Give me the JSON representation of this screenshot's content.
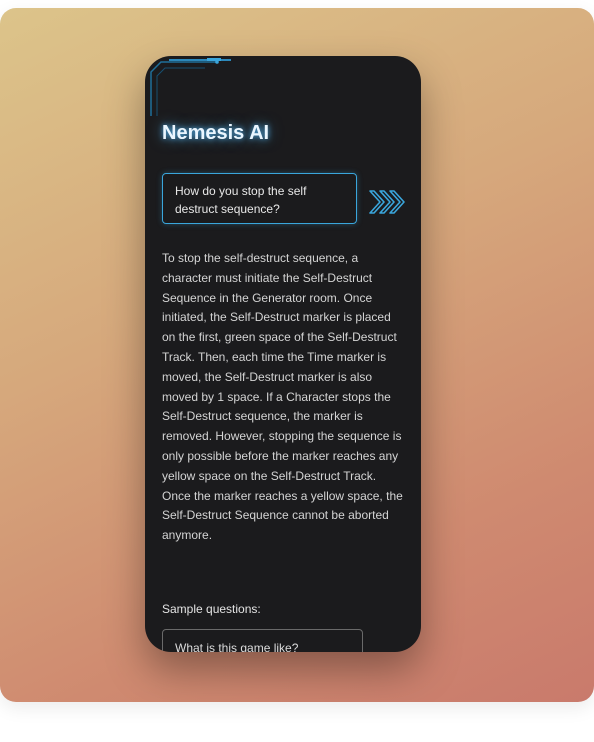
{
  "app": {
    "title": "Nemesis AI"
  },
  "question": {
    "text": "How do you stop the self destruct sequence?"
  },
  "send_button": {
    "icon": "triple-chevron-right-icon",
    "color": "#3aa6dc"
  },
  "answer": {
    "text": "To stop the self-destruct sequence, a character must initiate the Self-Destruct Sequence in the Generator room. Once initiated, the Self-Destruct marker is placed on the first, green space of the Self-Destruct Track. Then, each time the Time marker is moved, the Self-Destruct marker is also moved by 1 space. If a Character stops the Self-Destruct sequence, the marker is removed. However, stopping the sequence is only possible before the marker reaches any yellow space on the Self-Destruct Track. Once the marker reaches a yellow space, the Self-Destruct Sequence cannot be aborted anymore."
  },
  "samples": {
    "label": "Sample questions:",
    "items": [
      "What is this game like?"
    ]
  },
  "colors": {
    "accent": "#3aa6dc",
    "phone_bg": "#1b1b1d"
  }
}
